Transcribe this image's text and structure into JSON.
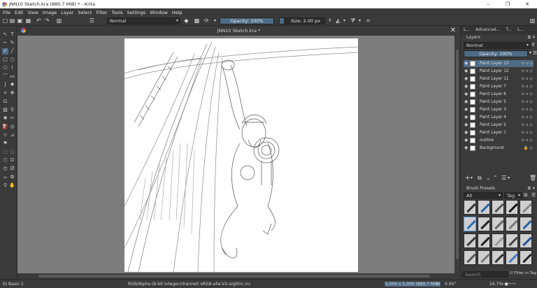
{
  "window": {
    "title": "JNN10 Sketch.kra (880.7 MiB)  * - Krita",
    "controls": [
      "–",
      "❐",
      "✕"
    ]
  },
  "menu": [
    "File",
    "Edit",
    "View",
    "Image",
    "Layer",
    "Select",
    "Filter",
    "Tools",
    "Settings",
    "Window",
    "Help"
  ],
  "toolbar": {
    "blend_mode": "Normal",
    "opacity_label": "Opacity: 100%",
    "opacity_fraction": 1.0,
    "size_label": "Size: 2.00 px",
    "size_fraction": 0.1
  },
  "document": {
    "tab_title": "JNN10 Sketch.kra *"
  },
  "docker": {
    "tabs": [
      "L...",
      "Advanced...",
      "T...",
      "L..."
    ],
    "layers_title": "Layers",
    "blend_mode": "Normal",
    "opacity_label": "Opacity:  100%",
    "layers": [
      {
        "name": "Paint Layer 13",
        "selected": true,
        "locked": false
      },
      {
        "name": "Paint Layer 12",
        "selected": false,
        "locked": false
      },
      {
        "name": "Paint Layer 11",
        "selected": false,
        "locked": false
      },
      {
        "name": "Paint Layer 7",
        "selected": false,
        "locked": false
      },
      {
        "name": "Paint Layer 6",
        "selected": false,
        "locked": false
      },
      {
        "name": "Paint Layer 5",
        "selected": false,
        "locked": false
      },
      {
        "name": "Paint Layer 3",
        "selected": false,
        "locked": false
      },
      {
        "name": "Paint Layer 4",
        "selected": false,
        "locked": false
      },
      {
        "name": "Paint Layer 2",
        "selected": false,
        "locked": false
      },
      {
        "name": "Paint Layer 1",
        "selected": false,
        "locked": false
      },
      {
        "name": "outline",
        "selected": false,
        "locked": false
      },
      {
        "name": "Background",
        "selected": false,
        "locked": true
      }
    ],
    "presets_title": "Brush Presets",
    "preset_filter": "All",
    "preset_tag": "Tag",
    "search_placeholder": "Search",
    "filter_in_tag": "Filter in Tag"
  },
  "status": {
    "brush": "b) Basic-1",
    "color_info": "RGB/Alpha (8-bit integer/channel)  sRGB-elle-V2-srgbtrc.icc",
    "size_info": "5,000 x 5,000 (880.7 MiB)",
    "rotation": "0.00°",
    "zoom": "16.7%"
  }
}
